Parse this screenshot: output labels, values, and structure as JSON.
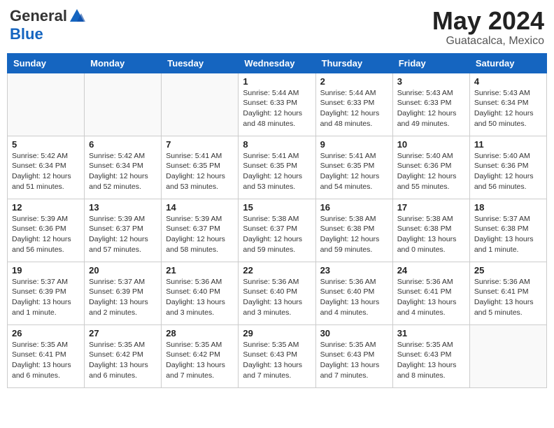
{
  "header": {
    "logo_general": "General",
    "logo_blue": "Blue",
    "month_year": "May 2024",
    "location": "Guatacalca, Mexico"
  },
  "weekdays": [
    "Sunday",
    "Monday",
    "Tuesday",
    "Wednesday",
    "Thursday",
    "Friday",
    "Saturday"
  ],
  "weeks": [
    [
      {
        "day": "",
        "info": ""
      },
      {
        "day": "",
        "info": ""
      },
      {
        "day": "",
        "info": ""
      },
      {
        "day": "1",
        "info": "Sunrise: 5:44 AM\nSunset: 6:33 PM\nDaylight: 12 hours\nand 48 minutes."
      },
      {
        "day": "2",
        "info": "Sunrise: 5:44 AM\nSunset: 6:33 PM\nDaylight: 12 hours\nand 48 minutes."
      },
      {
        "day": "3",
        "info": "Sunrise: 5:43 AM\nSunset: 6:33 PM\nDaylight: 12 hours\nand 49 minutes."
      },
      {
        "day": "4",
        "info": "Sunrise: 5:43 AM\nSunset: 6:34 PM\nDaylight: 12 hours\nand 50 minutes."
      }
    ],
    [
      {
        "day": "5",
        "info": "Sunrise: 5:42 AM\nSunset: 6:34 PM\nDaylight: 12 hours\nand 51 minutes."
      },
      {
        "day": "6",
        "info": "Sunrise: 5:42 AM\nSunset: 6:34 PM\nDaylight: 12 hours\nand 52 minutes."
      },
      {
        "day": "7",
        "info": "Sunrise: 5:41 AM\nSunset: 6:35 PM\nDaylight: 12 hours\nand 53 minutes."
      },
      {
        "day": "8",
        "info": "Sunrise: 5:41 AM\nSunset: 6:35 PM\nDaylight: 12 hours\nand 53 minutes."
      },
      {
        "day": "9",
        "info": "Sunrise: 5:41 AM\nSunset: 6:35 PM\nDaylight: 12 hours\nand 54 minutes."
      },
      {
        "day": "10",
        "info": "Sunrise: 5:40 AM\nSunset: 6:36 PM\nDaylight: 12 hours\nand 55 minutes."
      },
      {
        "day": "11",
        "info": "Sunrise: 5:40 AM\nSunset: 6:36 PM\nDaylight: 12 hours\nand 56 minutes."
      }
    ],
    [
      {
        "day": "12",
        "info": "Sunrise: 5:39 AM\nSunset: 6:36 PM\nDaylight: 12 hours\nand 56 minutes."
      },
      {
        "day": "13",
        "info": "Sunrise: 5:39 AM\nSunset: 6:37 PM\nDaylight: 12 hours\nand 57 minutes."
      },
      {
        "day": "14",
        "info": "Sunrise: 5:39 AM\nSunset: 6:37 PM\nDaylight: 12 hours\nand 58 minutes."
      },
      {
        "day": "15",
        "info": "Sunrise: 5:38 AM\nSunset: 6:37 PM\nDaylight: 12 hours\nand 59 minutes."
      },
      {
        "day": "16",
        "info": "Sunrise: 5:38 AM\nSunset: 6:38 PM\nDaylight: 12 hours\nand 59 minutes."
      },
      {
        "day": "17",
        "info": "Sunrise: 5:38 AM\nSunset: 6:38 PM\nDaylight: 13 hours\nand 0 minutes."
      },
      {
        "day": "18",
        "info": "Sunrise: 5:37 AM\nSunset: 6:38 PM\nDaylight: 13 hours\nand 1 minute."
      }
    ],
    [
      {
        "day": "19",
        "info": "Sunrise: 5:37 AM\nSunset: 6:39 PM\nDaylight: 13 hours\nand 1 minute."
      },
      {
        "day": "20",
        "info": "Sunrise: 5:37 AM\nSunset: 6:39 PM\nDaylight: 13 hours\nand 2 minutes."
      },
      {
        "day": "21",
        "info": "Sunrise: 5:36 AM\nSunset: 6:40 PM\nDaylight: 13 hours\nand 3 minutes."
      },
      {
        "day": "22",
        "info": "Sunrise: 5:36 AM\nSunset: 6:40 PM\nDaylight: 13 hours\nand 3 minutes."
      },
      {
        "day": "23",
        "info": "Sunrise: 5:36 AM\nSunset: 6:40 PM\nDaylight: 13 hours\nand 4 minutes."
      },
      {
        "day": "24",
        "info": "Sunrise: 5:36 AM\nSunset: 6:41 PM\nDaylight: 13 hours\nand 4 minutes."
      },
      {
        "day": "25",
        "info": "Sunrise: 5:36 AM\nSunset: 6:41 PM\nDaylight: 13 hours\nand 5 minutes."
      }
    ],
    [
      {
        "day": "26",
        "info": "Sunrise: 5:35 AM\nSunset: 6:41 PM\nDaylight: 13 hours\nand 6 minutes."
      },
      {
        "day": "27",
        "info": "Sunrise: 5:35 AM\nSunset: 6:42 PM\nDaylight: 13 hours\nand 6 minutes."
      },
      {
        "day": "28",
        "info": "Sunrise: 5:35 AM\nSunset: 6:42 PM\nDaylight: 13 hours\nand 7 minutes."
      },
      {
        "day": "29",
        "info": "Sunrise: 5:35 AM\nSunset: 6:43 PM\nDaylight: 13 hours\nand 7 minutes."
      },
      {
        "day": "30",
        "info": "Sunrise: 5:35 AM\nSunset: 6:43 PM\nDaylight: 13 hours\nand 7 minutes."
      },
      {
        "day": "31",
        "info": "Sunrise: 5:35 AM\nSunset: 6:43 PM\nDaylight: 13 hours\nand 8 minutes."
      },
      {
        "day": "",
        "info": ""
      }
    ]
  ]
}
